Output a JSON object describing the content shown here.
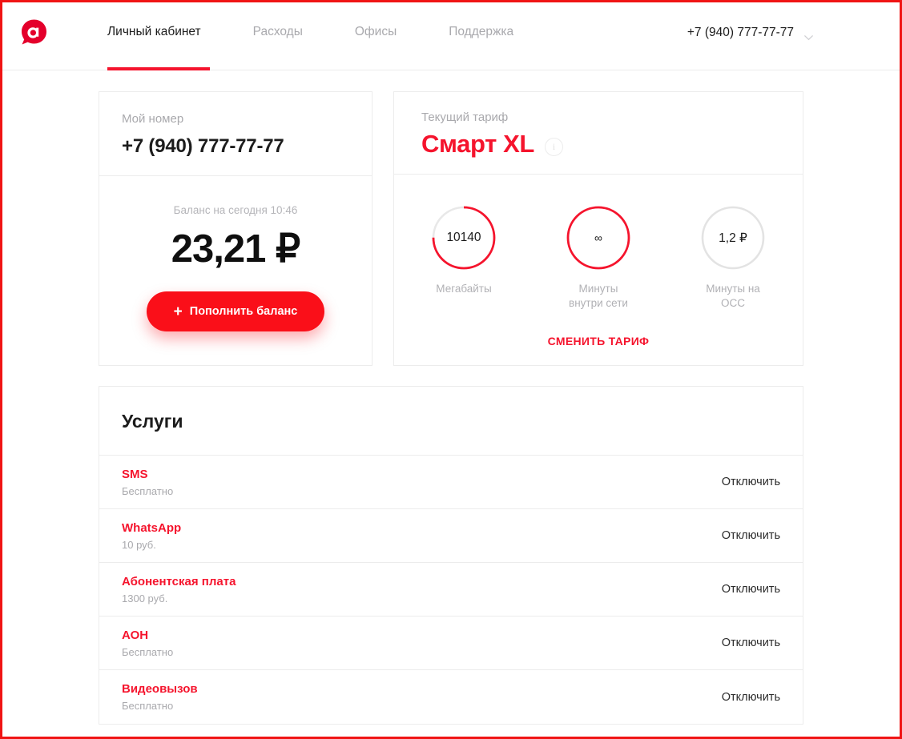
{
  "brand": {
    "logo_icon": "speech-bubble-a-logo",
    "accent_red": "#f5142d",
    "button_red": "#fa0f19",
    "muted_gray": "#a9a9ad"
  },
  "header": {
    "nav": [
      {
        "label": "Личный кабинет",
        "active": true
      },
      {
        "label": "Расходы",
        "active": false
      },
      {
        "label": "Офисы",
        "active": false
      },
      {
        "label": "Поддержка",
        "active": false
      }
    ],
    "account": {
      "phone": "+7 (940) 777-77-77",
      "chevron_icon": "chevron-down-icon"
    }
  },
  "number_card": {
    "label": "Мой номер",
    "phone": "+7 (940) 777-77-77",
    "balance_label": "Баланс на сегодня 10:46",
    "balance_value": "23,21 ₽",
    "topup_button": "Пополнить баланс",
    "topup_icon": "plus-icon"
  },
  "tariff_card": {
    "label": "Текущий тариф",
    "name": "Смарт XL",
    "info_icon": "info-icon",
    "gauges": [
      {
        "value": "10140",
        "caption": "Мегабайты",
        "percent": 75,
        "color": "#f5142d"
      },
      {
        "value": "∞",
        "caption": "Минуты\nвнутри сети",
        "caption_line1": "Минуты",
        "caption_line2": "внутри сети",
        "percent": 100,
        "color": "#f5142d"
      },
      {
        "value": "1,2 ₽",
        "caption": "Минуты на\nОСС",
        "caption_line1": "Минуты на",
        "caption_line2": "ОСС",
        "percent": 0,
        "color": "#e3e3e3"
      }
    ],
    "change_link": "СМЕНИТЬ ТАРИФ"
  },
  "services": {
    "title": "Услуги",
    "action_label": "Отключить",
    "items": [
      {
        "name": "SMS",
        "price": "Бесплатно",
        "action": "Отключить"
      },
      {
        "name": "WhatsApp",
        "price": "10 руб.",
        "action": "Отключить"
      },
      {
        "name": "Абонентская плата",
        "price": "1300 руб.",
        "action": "Отключить"
      },
      {
        "name": "АОН",
        "price": "Бесплатно",
        "action": "Отключить"
      },
      {
        "name": "Видеовызов",
        "price": "Бесплатно",
        "action": "Отключить"
      }
    ]
  }
}
